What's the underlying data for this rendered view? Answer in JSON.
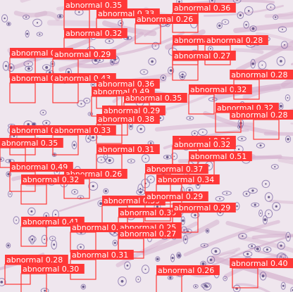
{
  "image": {
    "kind": "histology micrograph with detection overlay",
    "stain_colors": {
      "background": "#efe6ee",
      "stroma": "#d6b3cf",
      "nucleus": "#7e6aa6",
      "nucleus_dark": "#4d3f78"
    },
    "box_color": "#ff3838",
    "label_text_color": "#ffffff"
  },
  "detections": [
    {
      "class": "abnormal",
      "score": "0.35"
    },
    {
      "class": "abnormal",
      "score": "0.36"
    },
    {
      "class": "abnormal",
      "score": "0.33"
    },
    {
      "class": "abnormal",
      "score": "0.26"
    },
    {
      "class": "abnormal",
      "score": "0.32"
    },
    {
      "class": "abnormal",
      "score": "0.30"
    },
    {
      "class": "abnormal",
      "score": "0.29"
    },
    {
      "class": "abnormal",
      "score": "0.40"
    },
    {
      "class": "abnormal",
      "score": "0.28"
    },
    {
      "class": "abnormal",
      "score": "0.27"
    },
    {
      "class": "abnormal",
      "score": "0.44"
    },
    {
      "class": "abnormal",
      "score": "0.43"
    },
    {
      "class": "abnormal",
      "score": "0.36"
    },
    {
      "class": "abnormal",
      "score": "0.49"
    },
    {
      "class": "abnormal",
      "score": "0.32"
    },
    {
      "class": "abnormal",
      "score": "0.35"
    },
    {
      "class": "abnormal",
      "score": "0.29"
    },
    {
      "class": "abnormal",
      "score": "0.38"
    },
    {
      "class": "abnormal",
      "score": "0.36"
    },
    {
      "class": "abnormal",
      "score": "0.33"
    },
    {
      "class": "abnormal",
      "score": "0.35"
    },
    {
      "class": "abnormal",
      "score": "0.31"
    },
    {
      "class": "abnormal",
      "score": "0.26"
    },
    {
      "class": "abnormal",
      "score": "0.32"
    },
    {
      "class": "abnormal",
      "score": "0.51"
    },
    {
      "class": "abnormal",
      "score": "0.49"
    },
    {
      "class": "abnormal",
      "score": "0.37"
    },
    {
      "class": "abnormal",
      "score": "0.26"
    },
    {
      "class": "abnormal",
      "score": "0.32"
    },
    {
      "class": "abnormal",
      "score": "0.34"
    },
    {
      "class": "abnormal",
      "score": "0.39"
    },
    {
      "class": "abnormal",
      "score": "0.29"
    },
    {
      "class": "abnormal",
      "score": "0.35"
    },
    {
      "class": "abnormal",
      "score": "0.29"
    },
    {
      "class": "abnormal",
      "score": "0.41"
    },
    {
      "class": "abnormal",
      "score": "0.36"
    },
    {
      "class": "abnormal",
      "score": "0.25"
    },
    {
      "class": "abnormal",
      "score": "0.27"
    },
    {
      "class": "abnormal",
      "score": "0.31"
    },
    {
      "class": "abnormal",
      "score": "0.28"
    },
    {
      "class": "abnormal",
      "score": "0.30"
    },
    {
      "class": "abnormal",
      "score": "0.26"
    },
    {
      "class": "abnormal",
      "score": "0.40"
    },
    {
      "class": "abnormal",
      "score": "0.28"
    },
    {
      "class": "abnormal",
      "score": "0.32"
    },
    {
      "class": "abnormal",
      "score": "0.28"
    }
  ]
}
